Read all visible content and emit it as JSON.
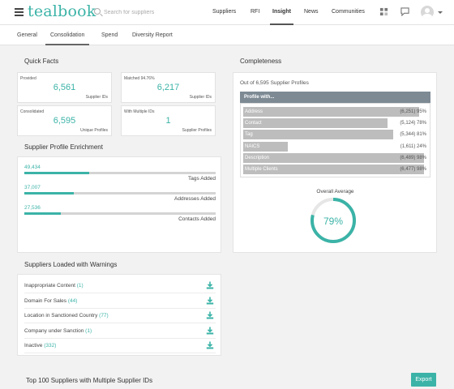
{
  "app": {
    "logo": "tealbook"
  },
  "search": {
    "placeholder": "Search for suppliers"
  },
  "topnav": [
    "Suppliers",
    "RFI",
    "Insight",
    "News",
    "Communities"
  ],
  "subnav": [
    "General",
    "Consolidation",
    "Spend",
    "Diversity Report"
  ],
  "quick_facts": {
    "title": "Quick Facts",
    "boxes": [
      {
        "label": "Provided",
        "value": "6,561",
        "sub": "Supplier IDs"
      },
      {
        "label": "Matched 94.76%",
        "value": "6,217",
        "sub": "Supplier IDs"
      },
      {
        "label": "Consolidated",
        "value": "6,595",
        "sub": "Unique Profiles"
      },
      {
        "label": "With Multiple IDs",
        "value": "1",
        "sub": "Supplier Profiles"
      }
    ]
  },
  "enrichment": {
    "title": "Supplier Profile Enrichment",
    "rows": [
      {
        "value": "49,434",
        "label": "Tags Added",
        "fraction": 0.34
      },
      {
        "value": "37,007",
        "label": "Addresses Added",
        "fraction": 0.26
      },
      {
        "value": "27,536",
        "label": "Contacts Added",
        "fraction": 0.19
      }
    ]
  },
  "warnings": {
    "title": "Suppliers Loaded with Warnings",
    "rows": [
      {
        "label": "Inappropriate Content",
        "count": "(1)"
      },
      {
        "label": "Domain For Sales",
        "count": "(44)"
      },
      {
        "label": "Location in Sanctioned Country",
        "count": "(77)"
      },
      {
        "label": "Company under Sanction",
        "count": "(1)"
      },
      {
        "label": "Inactive",
        "count": "(332)"
      }
    ]
  },
  "completeness": {
    "title": "Completeness",
    "subtitle": "Out of 6,595 Supplier Profiles",
    "header": "Profile with...",
    "rows": [
      {
        "name": "Address",
        "value": "(6,251) 95%",
        "pct": 95
      },
      {
        "name": "Contact",
        "value": "(5,124) 78%",
        "pct": 78
      },
      {
        "name": "Tag",
        "value": "(5,344) 81%",
        "pct": 81
      },
      {
        "name": "NAICS",
        "value": "(1,611) 24%",
        "pct": 24
      },
      {
        "name": "Description",
        "value": "(6,489) 98%",
        "pct": 98
      },
      {
        "name": "Multiple Clients",
        "value": "(6,477) 98%",
        "pct": 98
      }
    ],
    "average_label": "Overall Average",
    "average_value": "79%",
    "average_pct": 79
  },
  "bottom": {
    "title": "Top 100 Suppliers with Multiple Supplier IDs",
    "export_label": "Export"
  },
  "colors": {
    "accent": "#3bb3a7",
    "header_bar": "#7d8a94",
    "bar": "#bdbdbd"
  },
  "icons": [
    "menu-icon",
    "search-icon",
    "org-chart-icon",
    "chat-icon",
    "avatar-icon",
    "download-icon"
  ]
}
